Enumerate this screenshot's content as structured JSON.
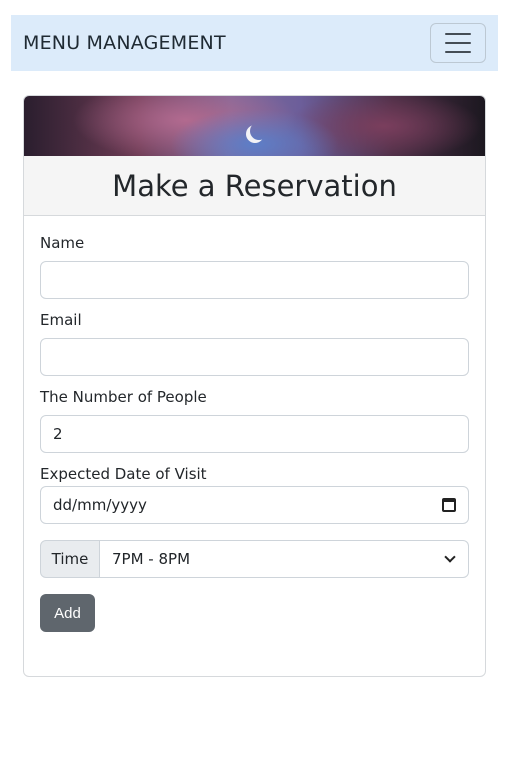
{
  "navbar": {
    "brand": "MENU MANAGEMENT"
  },
  "card": {
    "title": "Make a Reservation"
  },
  "form": {
    "name_label": "Name",
    "name_value": "",
    "email_label": "Email",
    "email_value": "",
    "people_label": "The Number of People",
    "people_value": "2",
    "date_label": "Expected Date of Visit",
    "date_value": "dd/mm/yyyy",
    "time_label": "Time",
    "time_value": "7PM - 8PM",
    "add_label": "Add"
  },
  "icons": {
    "menu": "hamburger-icon",
    "calendar": "calendar-icon",
    "dropdown": "chevron-down-icon"
  }
}
